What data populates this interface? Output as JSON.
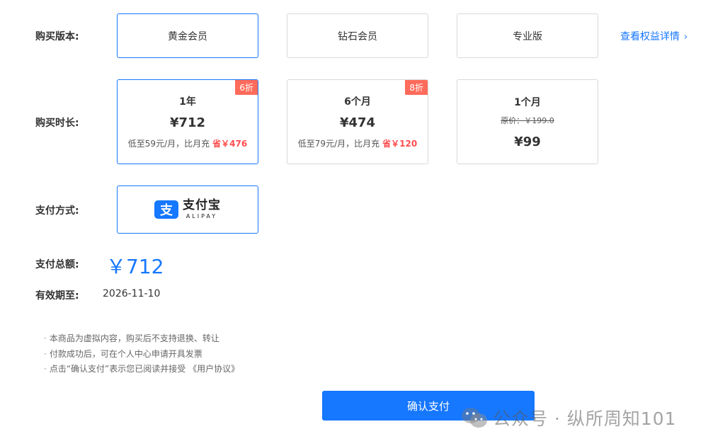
{
  "labels": {
    "version": "购买版本:",
    "duration": "购买时长:",
    "payment": "支付方式:",
    "total": "支付总额:",
    "expiry": "有效期至:"
  },
  "versions": [
    {
      "label": "黄金会员",
      "selected": true
    },
    {
      "label": "钻石会员",
      "selected": false
    },
    {
      "label": "专业版",
      "selected": false
    }
  ],
  "detail_link": {
    "label": "查看权益详情",
    "icon": "chevron-right-icon"
  },
  "durations": [
    {
      "period": "1年",
      "price": "¥712",
      "note": "低至59元/月，比月充",
      "save": "省￥476",
      "badge": "6折",
      "selected": true
    },
    {
      "period": "6个月",
      "price": "¥474",
      "note": "低至79元/月，比月充",
      "save": "省￥120",
      "badge": "8折",
      "selected": false
    },
    {
      "period": "1个月",
      "original_price": "原价：￥199.0",
      "price": "¥99",
      "selected": false
    }
  ],
  "payment": {
    "method_cn": "支付宝",
    "method_en": "ALIPAY",
    "icon_glyph": "支",
    "icon": "alipay-icon",
    "selected": true
  },
  "total_amount": "￥712",
  "expiry_date": "2026-11-10",
  "notes": [
    "本商品为虚拟内容，购买后不支持退换、转让",
    "付款成功后，可在个人中心申请开具发票",
    "点击“确认支付”表示您已阅读并接受 《用户协议》"
  ],
  "confirm_label": "确认支付",
  "watermark": {
    "text": "公众号 · 纵所周知101",
    "icon": "wechat-icon"
  },
  "colors": {
    "accent": "#1677ff",
    "badge": "#ff6b5b",
    "save": "#ff4d4f",
    "border": "#d9d9d9"
  }
}
